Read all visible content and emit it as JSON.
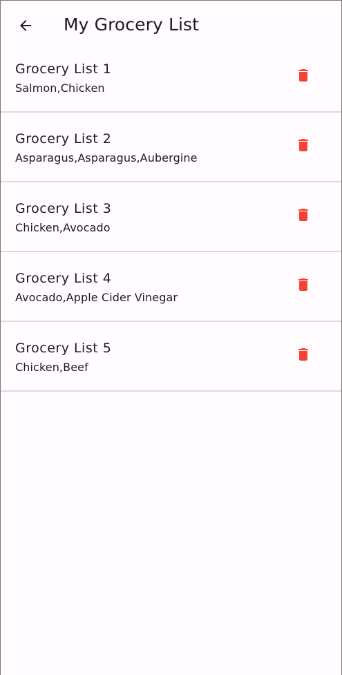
{
  "app_bar": {
    "title": "My Grocery List",
    "back_icon": "arrow-back-icon"
  },
  "accent_colors": {
    "delete": "#f44336",
    "divider": "#dedbe0"
  },
  "lists": [
    {
      "title": "Grocery List 1",
      "items": "Salmon,Chicken",
      "icon": "trash-icon"
    },
    {
      "title": "Grocery List 2",
      "items": "Asparagus,Asparagus,Aubergine",
      "icon": "trash-icon"
    },
    {
      "title": "Grocery List 3",
      "items": "Chicken,Avocado",
      "icon": "trash-icon"
    },
    {
      "title": "Grocery List 4",
      "items": "Avocado,Apple Cider Vinegar",
      "icon": "trash-icon"
    },
    {
      "title": "Grocery List 5",
      "items": "Chicken,Beef",
      "icon": "trash-icon"
    }
  ]
}
